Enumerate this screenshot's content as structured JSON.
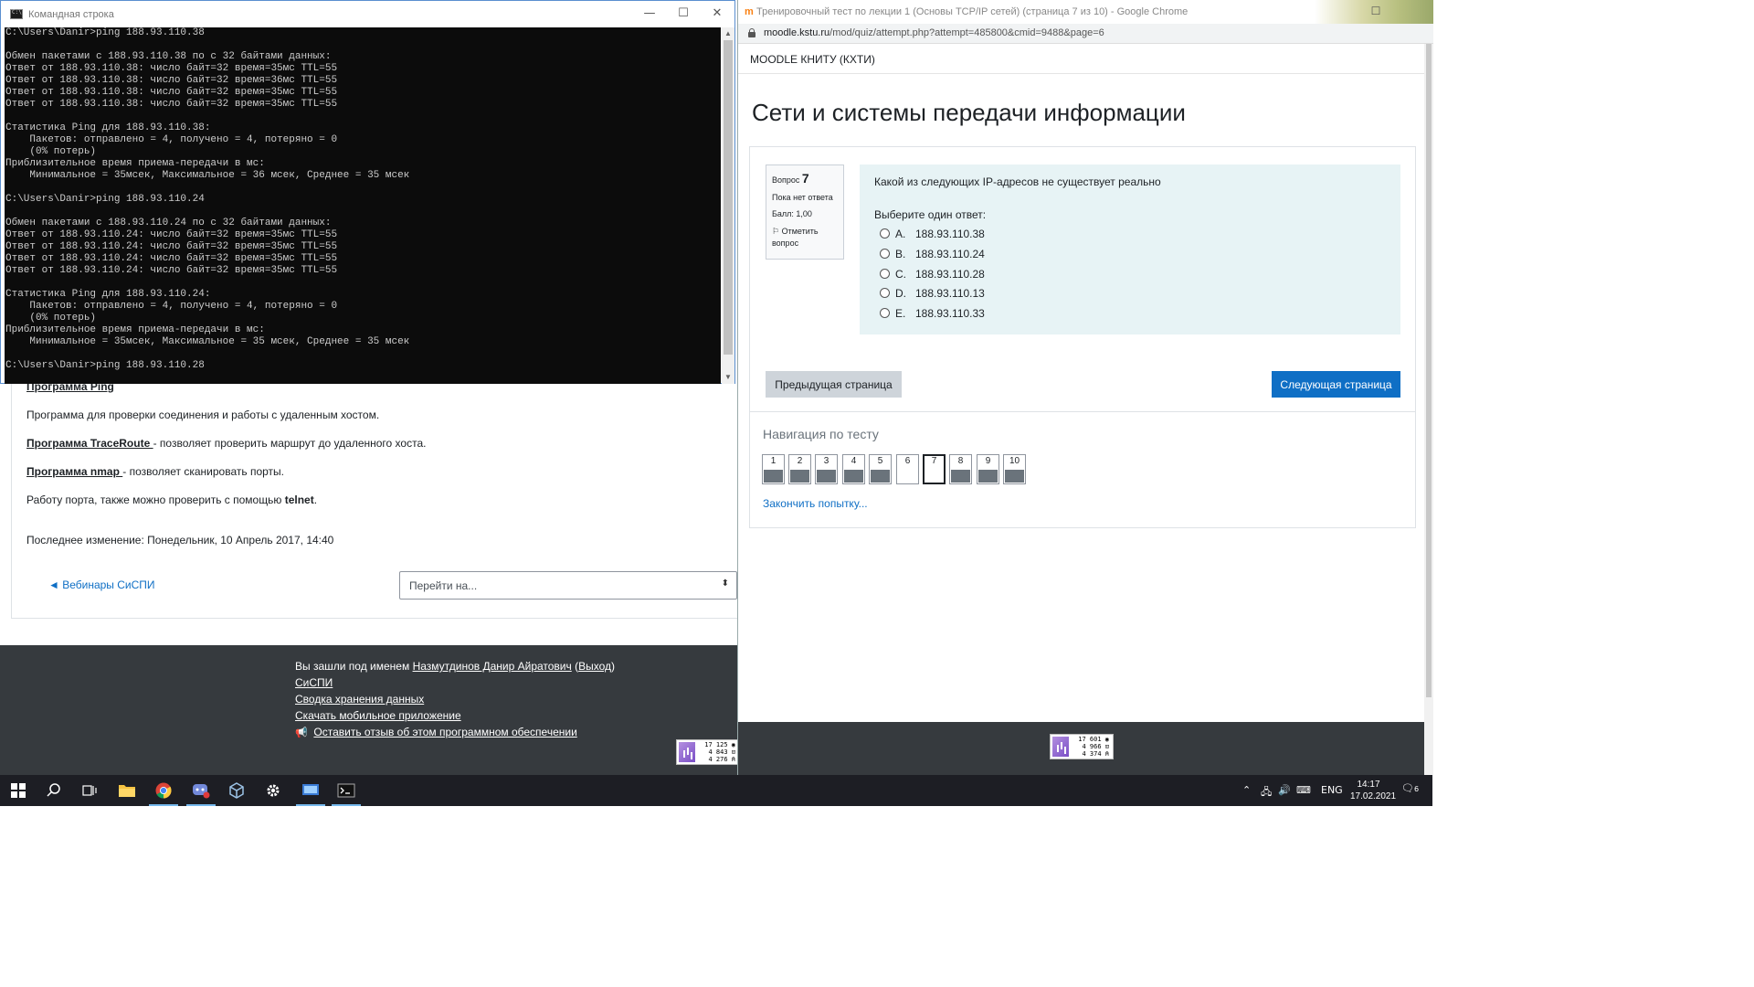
{
  "cmd": {
    "title": "Командная строка",
    "lines": [
      "C:\\Users\\Danir>ping 188.93.110.38",
      "",
      "Обмен пакетами с 188.93.110.38 по с 32 байтами данных:",
      "Ответ от 188.93.110.38: число байт=32 время=35мс TTL=55",
      "Ответ от 188.93.110.38: число байт=32 время=36мс TTL=55",
      "Ответ от 188.93.110.38: число байт=32 время=35мс TTL=55",
      "Ответ от 188.93.110.38: число байт=32 время=35мс TTL=55",
      "",
      "Статистика Ping для 188.93.110.38:",
      "    Пакетов: отправлено = 4, получено = 4, потеряно = 0",
      "    (0% потерь)",
      "Приблизительное время приема-передачи в мс:",
      "    Минимальное = 35мсек, Максимальное = 36 мсек, Среднее = 35 мсек",
      "",
      "C:\\Users\\Danir>ping 188.93.110.24",
      "",
      "Обмен пакетами с 188.93.110.24 по с 32 байтами данных:",
      "Ответ от 188.93.110.24: число байт=32 время=35мс TTL=55",
      "Ответ от 188.93.110.24: число байт=32 время=35мс TTL=55",
      "Ответ от 188.93.110.24: число байт=32 время=35мс TTL=55",
      "Ответ от 188.93.110.24: число байт=32 время=35мс TTL=55",
      "",
      "Статистика Ping для 188.93.110.24:",
      "    Пакетов: отправлено = 4, получено = 4, потеряно = 0",
      "    (0% потерь)",
      "Приблизительное время приема-передачи в мс:",
      "    Минимальное = 35мсек, Максимальное = 35 мсек, Среднее = 35 мсек",
      "",
      "C:\\Users\\Danir>ping 188.93.110.28"
    ]
  },
  "background_page": {
    "ping_heading": "Программа Ping",
    "ping_desc": "Программа для проверки соединения и работы с удаленным хостом.",
    "traceroute_name": "Программа TraceRoute ",
    "traceroute_desc": "- позволяет проверить маршрут до удаленного хоста.",
    "nmap_name": "Программа nmap ",
    "nmap_desc": "- позволяет сканировать порты.",
    "telnet_prefix": "Работу порта, также можно проверить с помощью ",
    "telnet_name": "telnet",
    "telnet_suffix": ".",
    "last_modified": "Последнее изменение: Понедельник, 10 Апрель 2017, 14:40",
    "prev_link": "◄ Вебинары СиСПИ",
    "jump_placeholder": "Перейти на...",
    "footer": {
      "logged_prefix": "Вы зашли под именем ",
      "user_name": "Назмутдинов Данир Айратович",
      "logout": "Выход",
      "link1": "СиСПИ",
      "link2": "Сводка хранения данных",
      "link3": "Скачать мобильное приложение",
      "feedback": "Оставить отзыв об этом программном обеспечении"
    },
    "counter_lines": [
      "17 125 ◉",
      "4 843 ⊡",
      "4 276 ⍝"
    ]
  },
  "chrome": {
    "tab_title": "Тренировочный тест по лекции 1 (Основы TCP/IP сетей) (страница 7 из 10) - Google Chrome",
    "url_host": "moodle.kstu.ru",
    "url_path": "/mod/quiz/attempt.php?attempt=485800&cmid=9488&page=6",
    "brand": "MOODLE КНИТУ (КХТИ)",
    "heading": "Сети и системы передачи информации",
    "question": {
      "label": "Вопрос",
      "number": "7",
      "status": "Пока нет ответа",
      "grade": "Балл: 1,00",
      "flag": "Отметить вопрос",
      "text": "Какой из следующих IP-адресов не существует реально",
      "prompt": "Выберите один ответ:",
      "options": [
        {
          "letter": "A.",
          "value": "188.93.110.38"
        },
        {
          "letter": "B.",
          "value": "188.93.110.24"
        },
        {
          "letter": "C.",
          "value": "188.93.110.28"
        },
        {
          "letter": "D.",
          "value": "188.93.110.13"
        },
        {
          "letter": "E.",
          "value": "188.93.110.33"
        }
      ]
    },
    "prev_button": "Предыдущая страница",
    "next_button": "Следующая страница",
    "nav_title": "Навигация по тесту",
    "nav_pages": [
      "1",
      "2",
      "3",
      "4",
      "5",
      "6",
      "7",
      "8",
      "9",
      "10"
    ],
    "finish_link": "Закончить попытку...",
    "counter_lines": [
      "17 601 ◉",
      "4 966 ⊡",
      "4 374 ⍝"
    ]
  },
  "taskbar": {
    "lang": "ENG",
    "time": "14:17",
    "date": "17.02.2021",
    "notifications": "6",
    "accent": "#76b9ed"
  }
}
